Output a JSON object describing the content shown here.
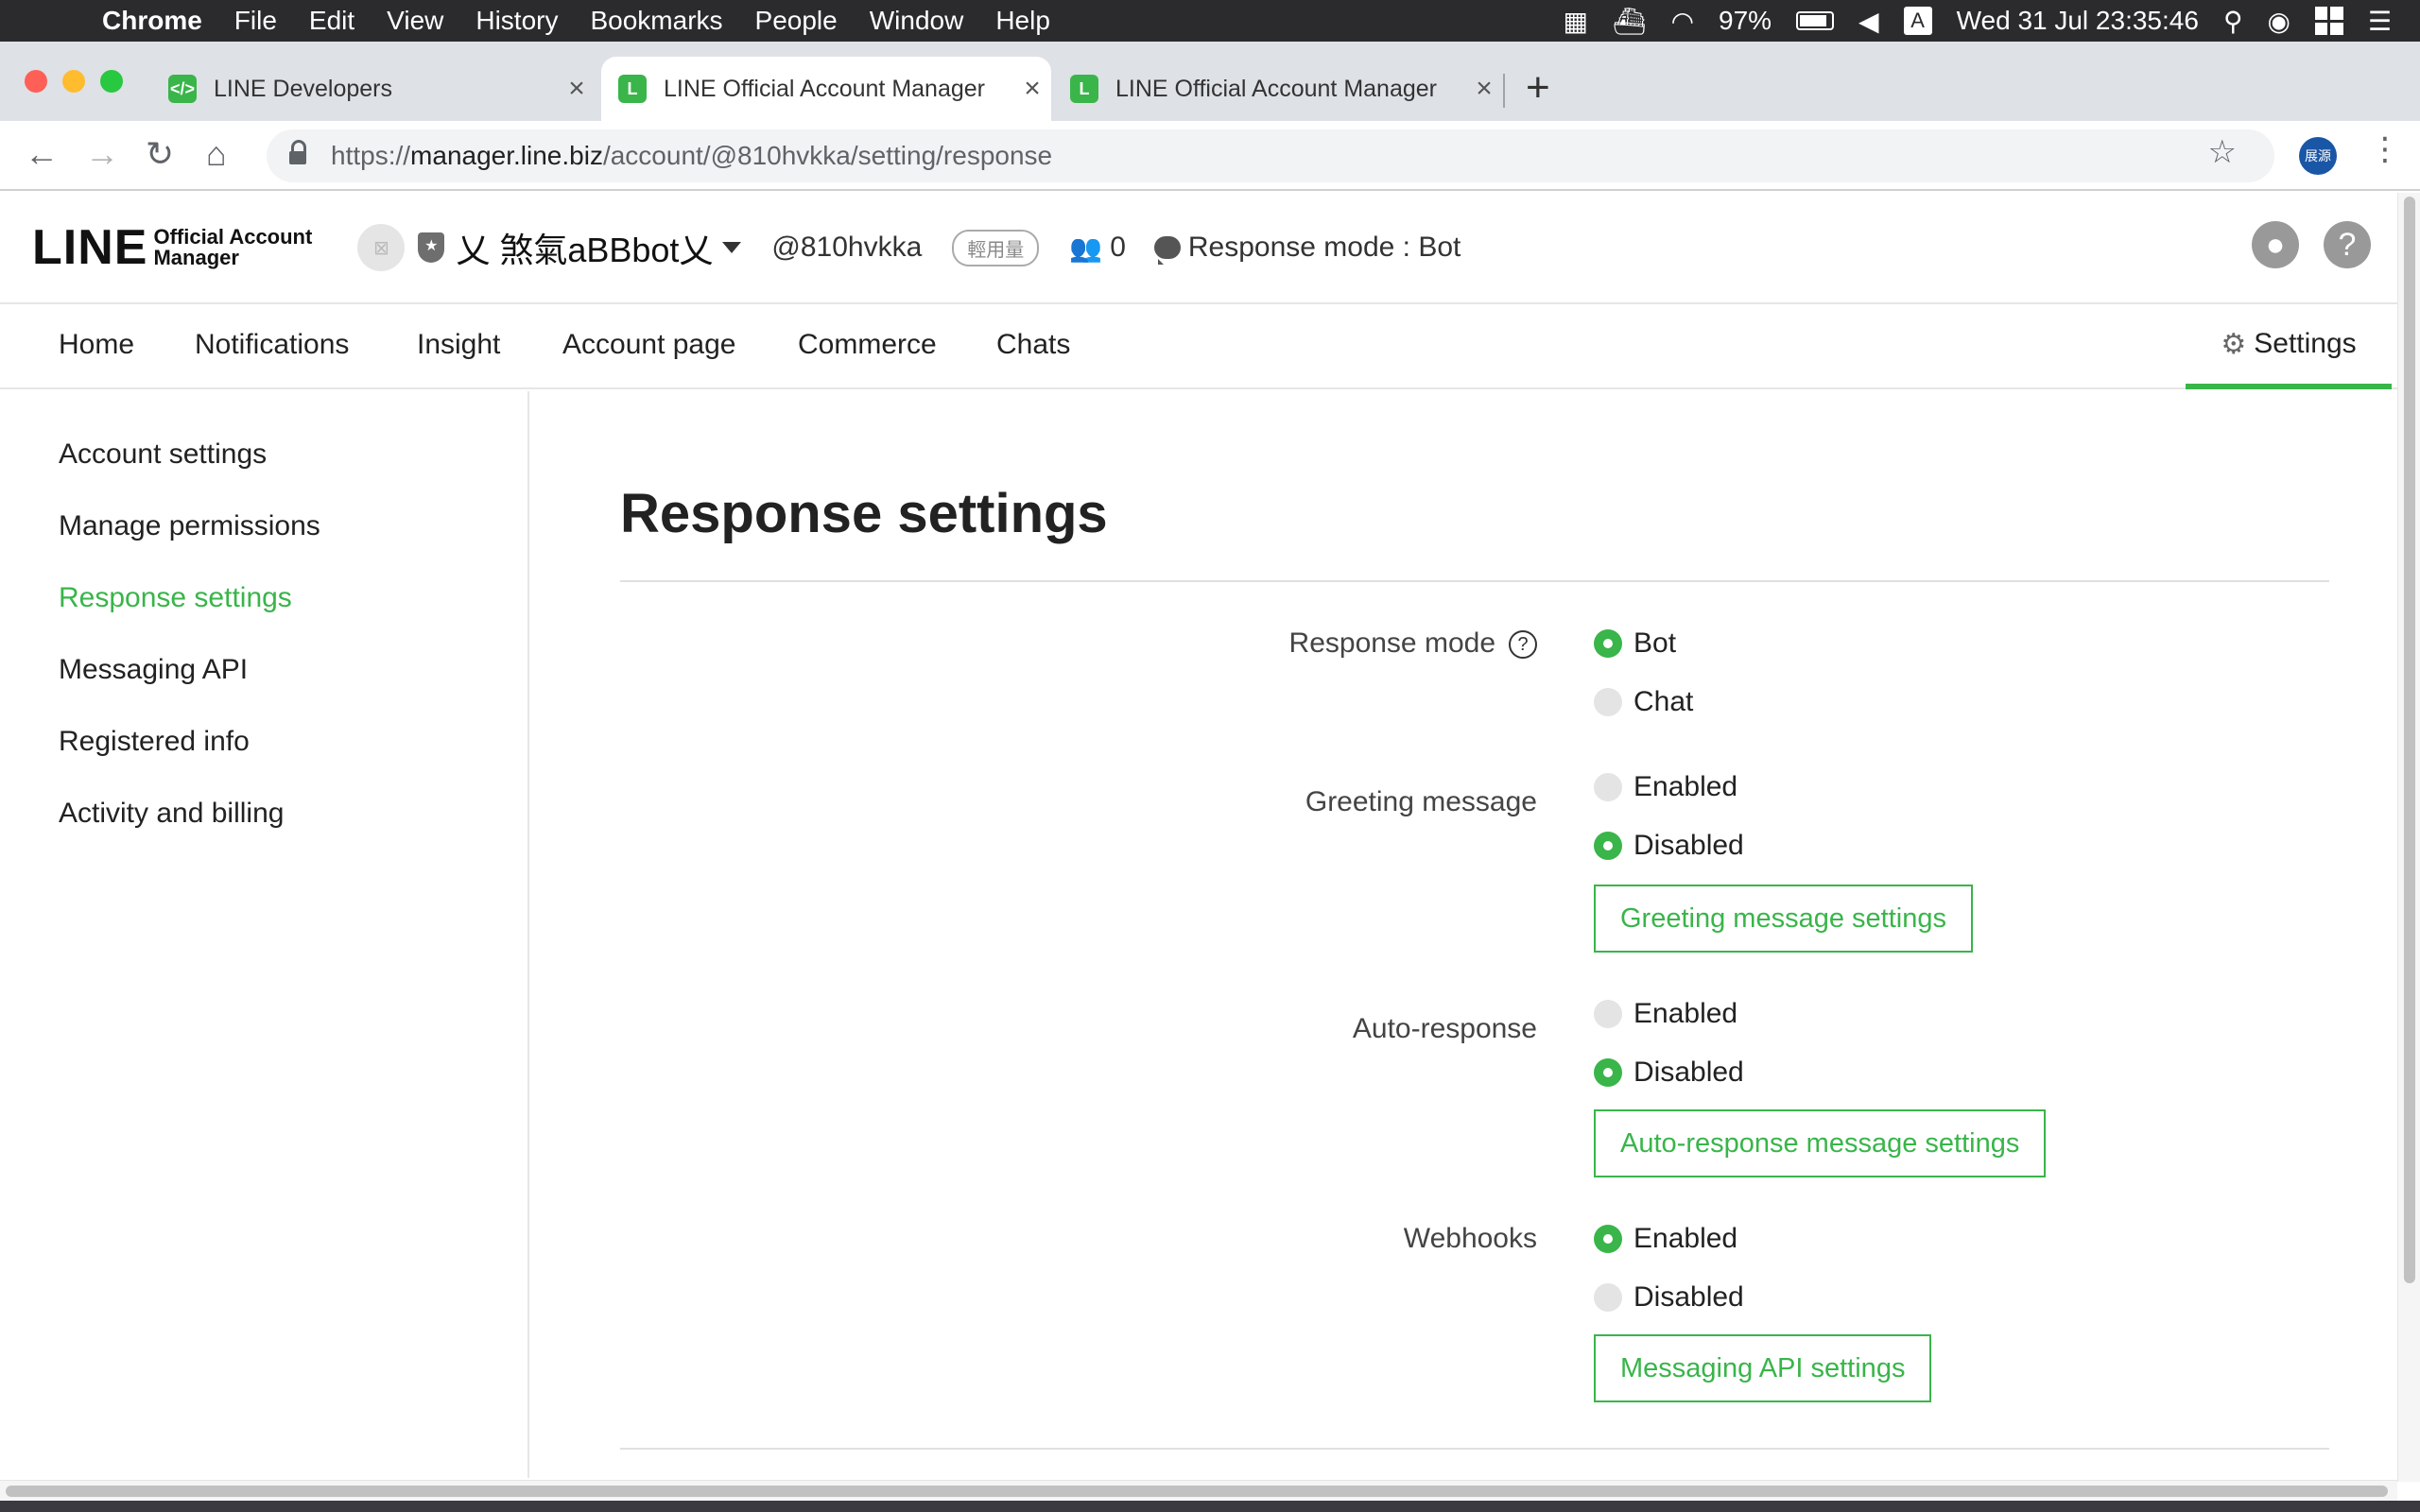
{
  "menubar": {
    "app": "Chrome",
    "items": [
      "File",
      "Edit",
      "View",
      "History",
      "Bookmarks",
      "People",
      "Window",
      "Help"
    ],
    "battery": "97%",
    "input_source": "A",
    "datetime": "Wed 31 Jul  23:35:46"
  },
  "tabs": [
    {
      "title": "LINE Developers",
      "favicon": "code-icon",
      "favicon_color": "#3ab54a"
    },
    {
      "title": "LINE Official Account Manager",
      "favicon": "line-l-icon",
      "favicon_color": "#3ab54a",
      "active": true
    },
    {
      "title": "LINE Official Account Manager",
      "favicon": "line-l-icon",
      "favicon_color": "#3ab54a"
    }
  ],
  "address": {
    "scheme": "https://",
    "host": "manager.line.biz",
    "path": "/account/@810hvkka/setting/response"
  },
  "profile": {
    "label": "展源"
  },
  "header": {
    "logo_word": "LINE",
    "logo_sub_1": "Official Account",
    "logo_sub_2": "Manager",
    "account_name": "乂 煞氣aBBbot乂",
    "account_id": "@810hvkka",
    "plan_badge": "輕用量",
    "friend_count": "0",
    "response_mode": "Response mode : Bot"
  },
  "nav": {
    "home": "Home",
    "notifications": "Notifications",
    "insight": "Insight",
    "account_page": "Account page",
    "commerce": "Commerce",
    "chats": "Chats",
    "settings": "Settings"
  },
  "sidebar": {
    "items": [
      {
        "label": "Account settings"
      },
      {
        "label": "Manage permissions"
      },
      {
        "label": "Response settings",
        "active": true
      },
      {
        "label": "Messaging API"
      },
      {
        "label": "Registered info"
      },
      {
        "label": "Activity and billing"
      }
    ]
  },
  "main": {
    "title": "Response settings",
    "response_mode": {
      "label": "Response mode",
      "options": [
        "Bot",
        "Chat"
      ],
      "selected": "Bot"
    },
    "greeting": {
      "label": "Greeting message",
      "options": [
        "Enabled",
        "Disabled"
      ],
      "selected": "Disabled",
      "button": "Greeting message settings"
    },
    "auto_response": {
      "label": "Auto-response",
      "options": [
        "Enabled",
        "Disabled"
      ],
      "selected": "Disabled",
      "button": "Auto-response message settings"
    },
    "webhooks": {
      "label": "Webhooks",
      "options": [
        "Enabled",
        "Disabled"
      ],
      "selected": "Enabled",
      "button": "Messaging API settings"
    }
  },
  "colors": {
    "accent": "#39b54a",
    "menubar": "#2b2b2e",
    "tabstrip": "#dee1e6"
  }
}
